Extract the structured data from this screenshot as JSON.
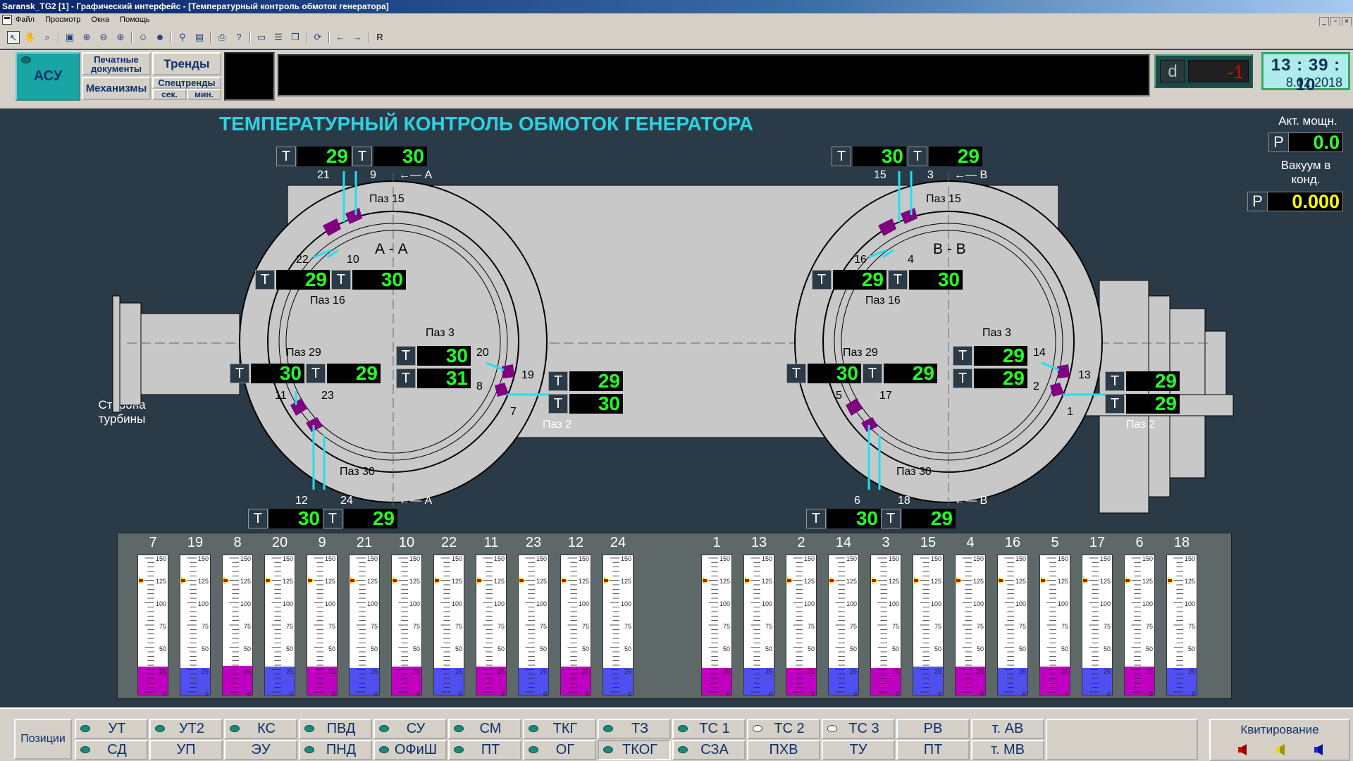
{
  "window": {
    "title": "Saransk_TG2 [1] - Графический интерфейс - [Температурный контроль обмоток генератора]",
    "menu": [
      "Файл",
      "Просмотр",
      "Окна",
      "Помощь"
    ],
    "toolbar_r": "R"
  },
  "header": {
    "asu": "АСУ",
    "print_docs": "Печатные документы",
    "trends": "Тренды",
    "mechanisms": "Механизмы",
    "spec_trends": "Спецтренды",
    "sec": "сек.",
    "min": "мин.",
    "d_label": "d",
    "d_value": "-1",
    "time": "13 : 39 : 10",
    "date": "8.02.2018"
  },
  "page": {
    "title": "ТЕМПЕРАТУРНЫЙ КОНТРОЛЬ ОБМОТОК ГЕНЕРАТОРА",
    "power_label": "Акт. мощн.",
    "power_p": "P",
    "power_value": "0.0",
    "vacuum_label": "Вакуум в конд.",
    "vacuum_p": "P",
    "vacuum_value": "0.000",
    "turbine_side": "Сторона турбины"
  },
  "diagram_labels": {
    "t": "T",
    "section_a": "А - А",
    "section_b": "В - В",
    "a_arrow": "←— А",
    "b_arrow": "←— В",
    "paz15": "Паз 15",
    "paz16": "Паз 16",
    "paz29": "Паз 29",
    "paz3": "Паз 3",
    "paz2": "Паз 2",
    "paz30": "Паз 30"
  },
  "sensors_a": {
    "top_21": "29",
    "top_9": "30",
    "p16_22": "29",
    "p16_10": "30",
    "p29_11": "30",
    "p29_23": "29",
    "p3_20": "30",
    "p3_8": "31",
    "p2_19": "29",
    "p2_7": "30",
    "bot_12": "30",
    "bot_24": "29",
    "n21": "21",
    "n9": "9",
    "n22": "22",
    "n10": "10",
    "n11": "11",
    "n23": "23",
    "n20": "20",
    "n19": "19",
    "n8": "8",
    "n7": "7",
    "n12": "12",
    "n24": "24"
  },
  "sensors_b": {
    "top_15": "30",
    "top_3": "29",
    "p16_16": "29",
    "p16_4": "30",
    "p29_5": "30",
    "p29_17": "29",
    "p3_14": "29",
    "p3_2": "29",
    "p2_13": "29",
    "p2_1": "29",
    "bot_6": "30",
    "bot_18": "29",
    "n15": "15",
    "n3": "3",
    "n16": "16",
    "n4": "4",
    "n5": "5",
    "n17": "17",
    "n14": "14",
    "n13": "13",
    "n2": "2",
    "n1": "1",
    "n6": "6",
    "n18": "18"
  },
  "gauge_ticks": [
    "150",
    "125",
    "100",
    "75",
    "50",
    "25",
    "0"
  ],
  "gauges": [
    {
      "n": "7",
      "v": 30,
      "c": "#c000c0"
    },
    {
      "n": "19",
      "v": 29,
      "c": "#5050f0"
    },
    {
      "n": "8",
      "v": 31,
      "c": "#c000c0"
    },
    {
      "n": "20",
      "v": 30,
      "c": "#5050f0"
    },
    {
      "n": "9",
      "v": 30,
      "c": "#c000c0"
    },
    {
      "n": "21",
      "v": 29,
      "c": "#5050f0"
    },
    {
      "n": "10",
      "v": 30,
      "c": "#c000c0"
    },
    {
      "n": "22",
      "v": 29,
      "c": "#5050f0"
    },
    {
      "n": "11",
      "v": 30,
      "c": "#c000c0"
    },
    {
      "n": "23",
      "v": 29,
      "c": "#5050f0"
    },
    {
      "n": "12",
      "v": 30,
      "c": "#c000c0"
    },
    {
      "n": "24",
      "v": 29,
      "c": "#5050f0"
    },
    {
      "n": "1",
      "v": 29,
      "c": "#c000c0"
    },
    {
      "n": "13",
      "v": 29,
      "c": "#5050f0"
    },
    {
      "n": "2",
      "v": 29,
      "c": "#c000c0"
    },
    {
      "n": "14",
      "v": 29,
      "c": "#5050f0"
    },
    {
      "n": "3",
      "v": 29,
      "c": "#c000c0"
    },
    {
      "n": "15",
      "v": 30,
      "c": "#5050f0"
    },
    {
      "n": "4",
      "v": 30,
      "c": "#c000c0"
    },
    {
      "n": "16",
      "v": 29,
      "c": "#5050f0"
    },
    {
      "n": "5",
      "v": 30,
      "c": "#c000c0"
    },
    {
      "n": "17",
      "v": 29,
      "c": "#5050f0"
    },
    {
      "n": "6",
      "v": 30,
      "c": "#c000c0"
    },
    {
      "n": "18",
      "v": 29,
      "c": "#5050f0"
    }
  ],
  "nav": {
    "positions": "Позиции",
    "row1": [
      "УТ",
      "УТ2",
      "КС",
      "ПВД",
      "СУ",
      "СМ",
      "ТКГ",
      "ТЗ",
      "ТС 1",
      "ТС 2",
      "ТС 3",
      "РВ",
      "т. АВ"
    ],
    "row2": [
      "СД",
      "УП",
      "ЭУ",
      "ПНД",
      "ОФиШ",
      "ПТ",
      "ОГ",
      "ТКОГ",
      "СЗА",
      "ПХВ",
      "ТУ",
      "ПТ",
      "т. МВ"
    ],
    "kvit": "Квитирование"
  },
  "colors": {
    "background": "#2b3a47",
    "value_green": "#22ff22",
    "vacuum_yellow": "#ffff00",
    "title_cyan": "#2ad4e0",
    "sensor_cyan": "#20e0f0",
    "slot_purple": "#800080",
    "fill_magenta": "#c000c0",
    "fill_blue": "#5050f0"
  }
}
